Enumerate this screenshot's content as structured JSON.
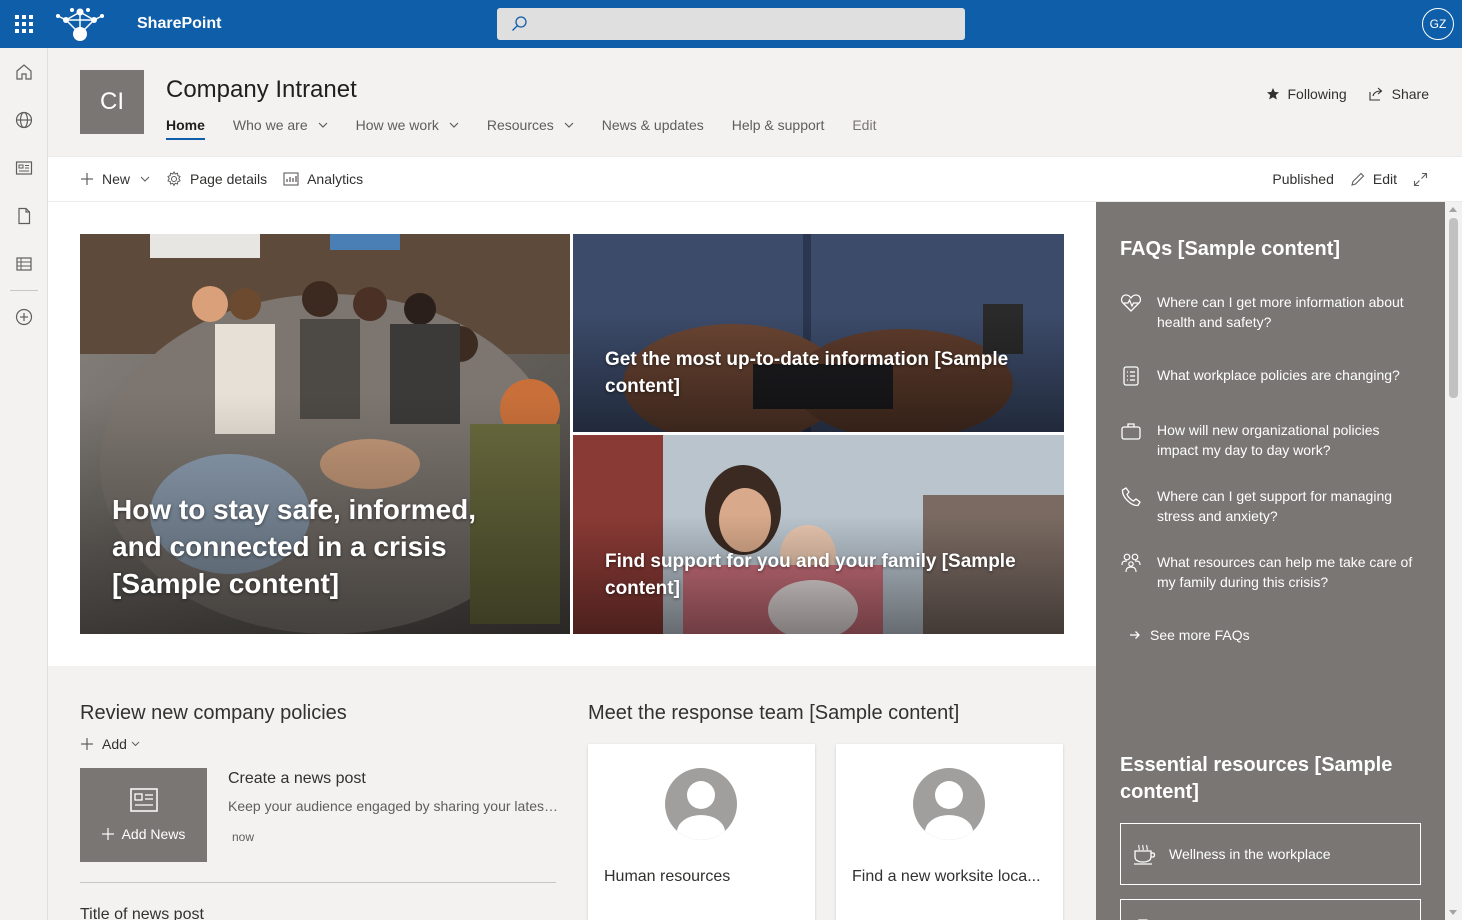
{
  "suitebar": {
    "app_name": "SharePoint",
    "search_placeholder": "",
    "avatar_initials": "GZ",
    "brand_color": "#0f5eaa"
  },
  "appbar": {
    "icons": [
      "home-icon",
      "globe-icon",
      "news-icon",
      "document-icon",
      "list-icon",
      "add-circle-icon"
    ]
  },
  "site": {
    "logo_text": "CI",
    "title": "Company Intranet",
    "nav": [
      {
        "label": "Home",
        "active": true,
        "dropdown": false
      },
      {
        "label": "Who we are",
        "active": false,
        "dropdown": true
      },
      {
        "label": "How we work",
        "active": false,
        "dropdown": true
      },
      {
        "label": "Resources",
        "active": false,
        "dropdown": true
      },
      {
        "label": "News & updates",
        "active": false,
        "dropdown": false
      },
      {
        "label": "Help & support",
        "active": false,
        "dropdown": false
      },
      {
        "label": "Edit",
        "active": false,
        "dropdown": false
      }
    ],
    "following_label": "Following",
    "share_label": "Share"
  },
  "commandbar": {
    "new_label": "New",
    "page_details_label": "Page details",
    "analytics_label": "Analytics",
    "status": "Published",
    "edit_label": "Edit"
  },
  "hero": {
    "tiles": [
      {
        "caption": "How to stay safe, informed, and connected in a crisis [Sample content]"
      },
      {
        "caption": "Get the most up-to-date information [Sample content]"
      },
      {
        "caption": "Find support for you and your family [Sample content]"
      }
    ]
  },
  "news": {
    "title": "Review new company policies",
    "add_label": "Add",
    "card_label": "Add News",
    "post_title": "Create a news post",
    "post_desc": "Keep your audience engaged by sharing your latest...",
    "post_time": "now",
    "next_title": "Title of news post"
  },
  "team": {
    "title": "Meet the response team [Sample content]",
    "people": [
      {
        "name": "Human resources"
      },
      {
        "name": "Find a new worksite loca..."
      }
    ]
  },
  "faq": {
    "title": "FAQs [Sample content]",
    "items": [
      {
        "icon": "heart-pulse-icon",
        "text": "Where can I get more information about health and safety?"
      },
      {
        "icon": "clipboard-list-icon",
        "text": "What workplace policies are changing?"
      },
      {
        "icon": "briefcase-icon",
        "text": "How will new organizational policies impact my day to day work?"
      },
      {
        "icon": "phone-icon",
        "text": "Where can I get support for managing stress and anxiety?"
      },
      {
        "icon": "family-icon",
        "text": "What resources can help me take care of my family during this crisis?"
      }
    ],
    "see_more": "See more FAQs",
    "essentials_title": "Essential resources [Sample content]",
    "resources": [
      {
        "icon": "coffee-cup-icon",
        "label": "Wellness in the workplace"
      },
      {
        "icon": "document-icon",
        "label": ""
      }
    ]
  }
}
